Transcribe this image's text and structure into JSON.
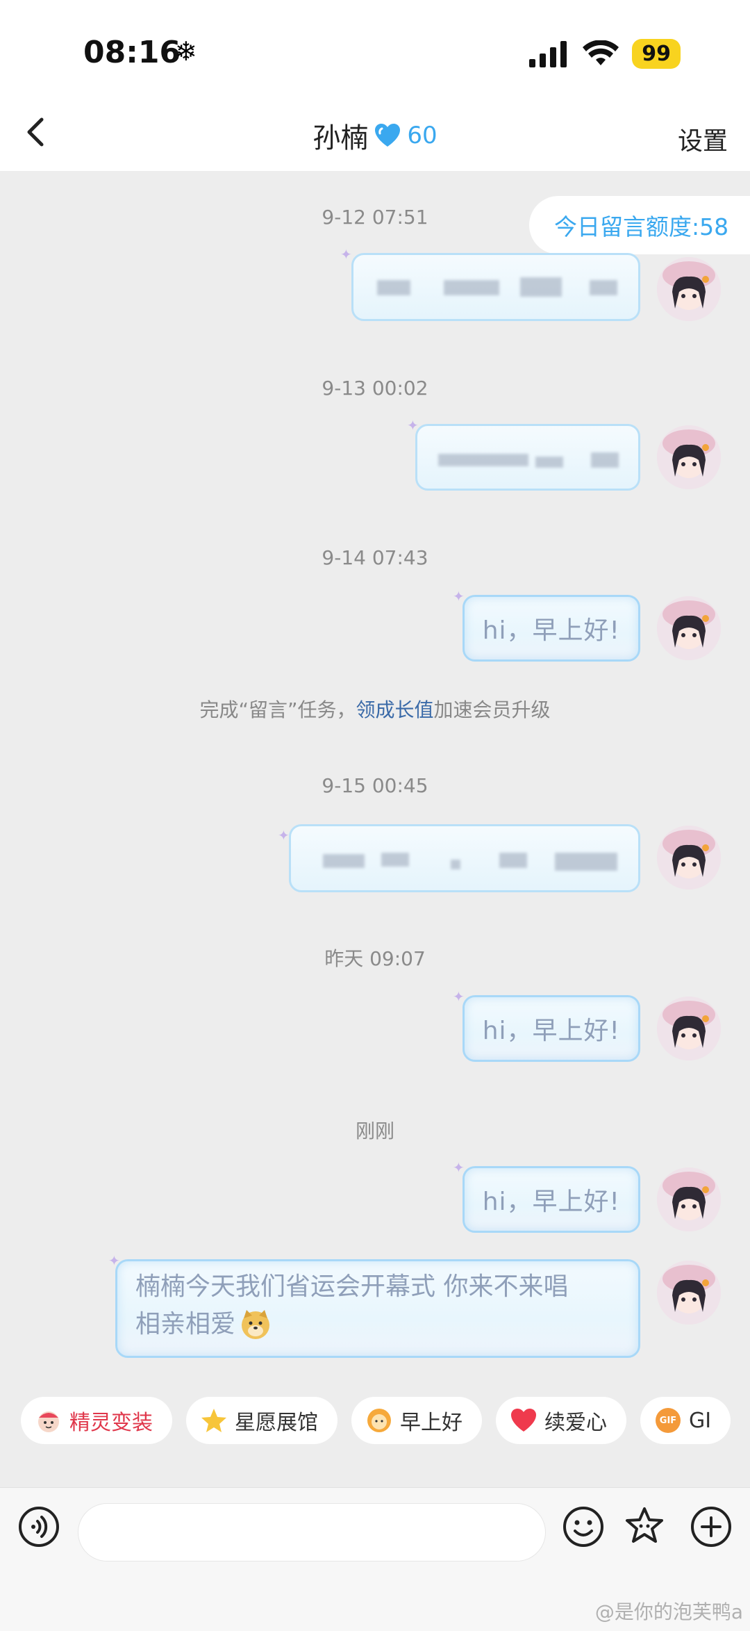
{
  "status": {
    "time": "08:16",
    "battery": "99"
  },
  "nav": {
    "title": "孙楠",
    "level": "60",
    "settings": "设置"
  },
  "quota": "今日留言额度:58",
  "timestamps": [
    "9-12 07:51",
    "9-13 00:02",
    "9-14 07:43",
    "9-15 00:45",
    "昨天 09:07",
    "刚刚"
  ],
  "messages": {
    "m3": "hi，早上好!",
    "m5": "hi，早上好!",
    "m6": "hi，早上好!",
    "m7_line1": "楠楠今天我们省运会开幕式 你来不来唱",
    "m7_line2": "相亲相爱"
  },
  "notice": {
    "pre": "完成“留言”任务，",
    "link": "领成长值",
    "post": "加速会员升级"
  },
  "chips": [
    {
      "label": "精灵变装",
      "icon": "sprite-icon"
    },
    {
      "label": "星愿展馆",
      "icon": "star-icon"
    },
    {
      "label": "早上好",
      "icon": "sun-face-icon"
    },
    {
      "label": "续爱心",
      "icon": "heart-icon"
    },
    {
      "label": "GI",
      "icon": "gif-icon",
      "badge": "GIF"
    }
  ],
  "watermark": "@是你的泡芙鸭a",
  "colors": {
    "accent": "#3aa8ef",
    "bubble_border": "#a8d8f8",
    "battery": "#f8d31f",
    "chip_red": "#e0364a"
  }
}
